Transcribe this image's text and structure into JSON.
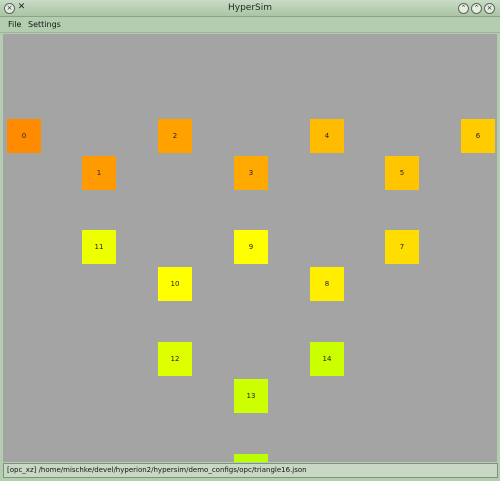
{
  "window": {
    "title": "HyperSim",
    "close_glyph": "×",
    "app_icon_glyph": "✕"
  },
  "menu": {
    "items": [
      "File",
      "Settings"
    ]
  },
  "canvas": {
    "background": "#a4a4a4",
    "leds": [
      {
        "label": "0",
        "color": "#ff8c00"
      },
      {
        "label": "1",
        "color": "#ff9a00"
      },
      {
        "label": "2",
        "color": "#ffa200"
      },
      {
        "label": "3",
        "color": "#ffaa00"
      },
      {
        "label": "4",
        "color": "#ffbb00"
      },
      {
        "label": "5",
        "color": "#ffc600"
      },
      {
        "label": "6",
        "color": "#ffcc00"
      },
      {
        "label": "7",
        "color": "#ffdd00"
      },
      {
        "label": "8",
        "color": "#ffee00"
      },
      {
        "label": "9",
        "color": "#ffff00"
      },
      {
        "label": "10",
        "color": "#ffff00"
      },
      {
        "label": "11",
        "color": "#eeff00"
      },
      {
        "label": "12",
        "color": "#ddff00"
      },
      {
        "label": "13",
        "color": "#ccff00"
      },
      {
        "label": "14",
        "color": "#ccff00"
      },
      {
        "label": "",
        "color": "#bbff00"
      }
    ]
  },
  "status": {
    "text": "[opc_xz] /home/mischke/devel/hyperion2/hypersim/demo_configs/opc/triangle16.json"
  }
}
